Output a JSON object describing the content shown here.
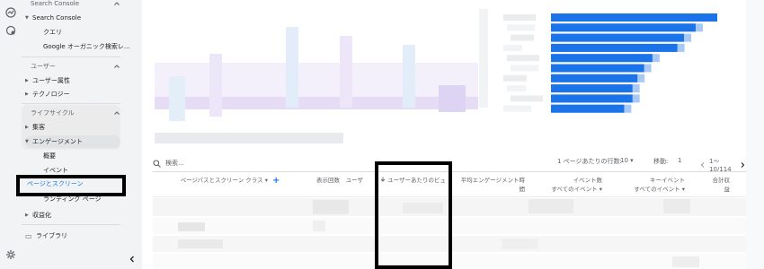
{
  "rail": {
    "icons": [
      "realtime-icon",
      "explore-icon",
      "settings-icon"
    ]
  },
  "sidebar": {
    "search_console": {
      "header": "Search Console",
      "group_label": "Search Console",
      "items": [
        "クエリ",
        "Google オーガニック検索レ..."
      ]
    },
    "user": {
      "header": "ユーザー",
      "items": [
        "ユーザー属性",
        "テクノロジー"
      ]
    },
    "lifecycle": {
      "header": "ライフサイクル",
      "items": [
        "集客",
        "エンゲージメント"
      ],
      "engagement_items": [
        "概要",
        "イベント",
        "ページとスクリーン",
        "ランディング ページ"
      ]
    },
    "monetization": "収益化",
    "library": "ライブラリ"
  },
  "table": {
    "search_placeholder": "検索...",
    "rows_per_page_label": "1 ページあたりの行数:",
    "rows_per_page_value": "10",
    "goto_label": "移動:",
    "goto_value": "1",
    "range": "1〜10/114",
    "columns": {
      "page": "ページパスとスクリーン クラス",
      "views": "表示回数",
      "users": "ユーザ",
      "views_per_user": "ユーザーあたりのビュ",
      "avg_engagement": "平均エンゲージメント時間",
      "event_count": "イベント数",
      "event_count_sub": "すべてのイベント",
      "key_events": "キーイベント",
      "key_events_sub": "すべてのイベント",
      "total_revenue": "合計収益"
    }
  },
  "chart_data": {
    "type": "bar",
    "orientation": "horizontal",
    "values_visible": false,
    "relative_lengths": [
      1.0,
      0.87,
      0.8,
      0.76,
      0.61,
      0.56,
      0.52,
      0.49,
      0.49,
      0.44
    ],
    "color": "#1a73e8"
  },
  "colors": {
    "accent": "#1a73e8",
    "highlight_box": "#000000"
  }
}
